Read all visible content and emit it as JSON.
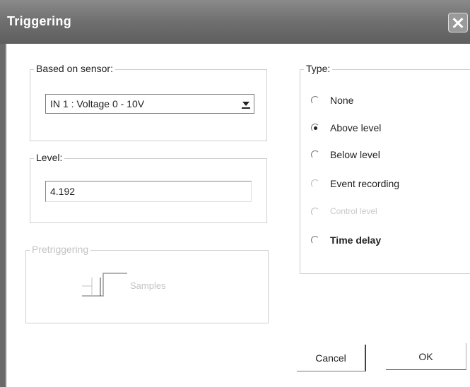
{
  "dialog": {
    "title": "Triggering"
  },
  "sensor": {
    "group_label": "Based on sensor:",
    "selected": "IN 1 : Voltage 0 - 10V"
  },
  "level": {
    "group_label": "Level:",
    "value": "4.192"
  },
  "pretrigger": {
    "group_label": "Pretriggering",
    "unit_label": "Samples",
    "enabled": false
  },
  "type": {
    "group_label": "Type:",
    "options": [
      {
        "label": "None",
        "checked": false,
        "enabled": true
      },
      {
        "label": "Above level",
        "checked": true,
        "enabled": true
      },
      {
        "label": "Below level",
        "checked": false,
        "enabled": true
      },
      {
        "label": "Event recording",
        "checked": false,
        "enabled": true
      },
      {
        "label": "Control level",
        "checked": false,
        "enabled": false
      },
      {
        "label": "Time delay",
        "checked": false,
        "enabled": true
      }
    ]
  },
  "buttons": {
    "cancel": "Cancel",
    "ok": "OK"
  }
}
